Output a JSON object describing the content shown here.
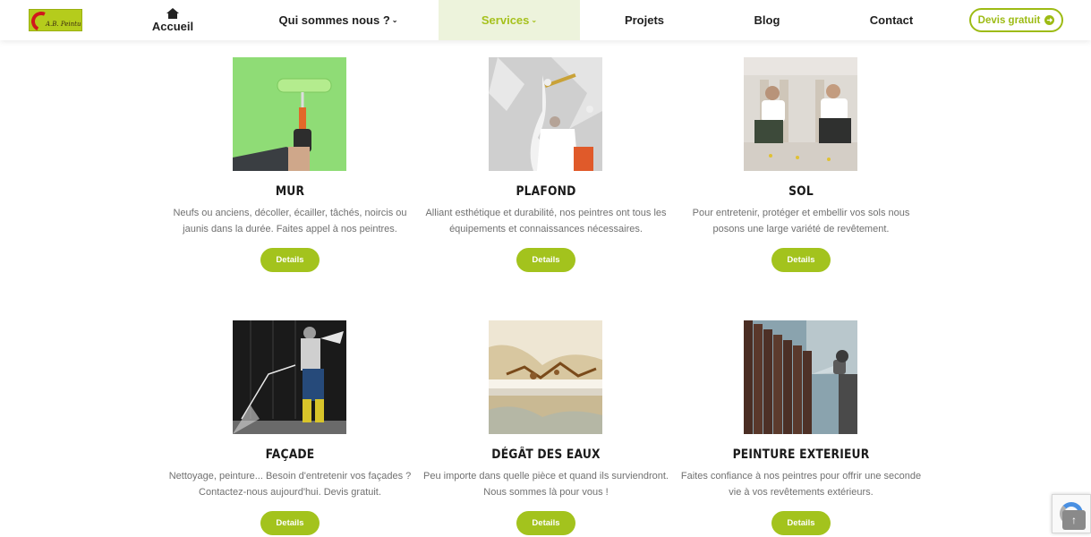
{
  "brand": {
    "logo_text": "A.B. Peinture"
  },
  "nav": {
    "home": "Accueil",
    "qui": "Qui sommes nous ?",
    "services": "Services",
    "projets": "Projets",
    "blog": "Blog",
    "contact": "Contact",
    "devis": "Devis gratuit",
    "active_color": "#a6c11d"
  },
  "cards": [
    {
      "title": "MUR",
      "desc": "Neufs ou anciens, décoller, écailler, tâchés, noircis ou jaunis dans la durée. Faites appel à nos peintres.",
      "button": "Details"
    },
    {
      "title": "PLAFOND",
      "desc": "Alliant esthétique et durabilité, nos peintres ont tous les équipements et connaissances nécessaires.",
      "button": "Details"
    },
    {
      "title": "SOL",
      "desc": "Pour entretenir, protéger et embellir vos sols nous posons une large variété de revêtement.",
      "button": "Details"
    },
    {
      "title": "FAÇADE",
      "desc": "Nettoyage, peinture... Besoin d'entretenir vos façades ? Contactez-nous aujourd'hui. Devis gratuit.",
      "button": "Details"
    },
    {
      "title": "DÉGÂT DES EAUX",
      "desc": "Peu importe dans quelle pièce et quand ils surviendront. Nous sommes là pour vous !",
      "button": "Details"
    },
    {
      "title": "PEINTURE EXTERIEUR",
      "desc": "Faites confiance à nos peintres pour offrir une seconde vie à vos revêtements extérieurs.",
      "button": "Details"
    }
  ],
  "colors": {
    "accent": "#a3c31d",
    "text_muted": "#707070"
  }
}
